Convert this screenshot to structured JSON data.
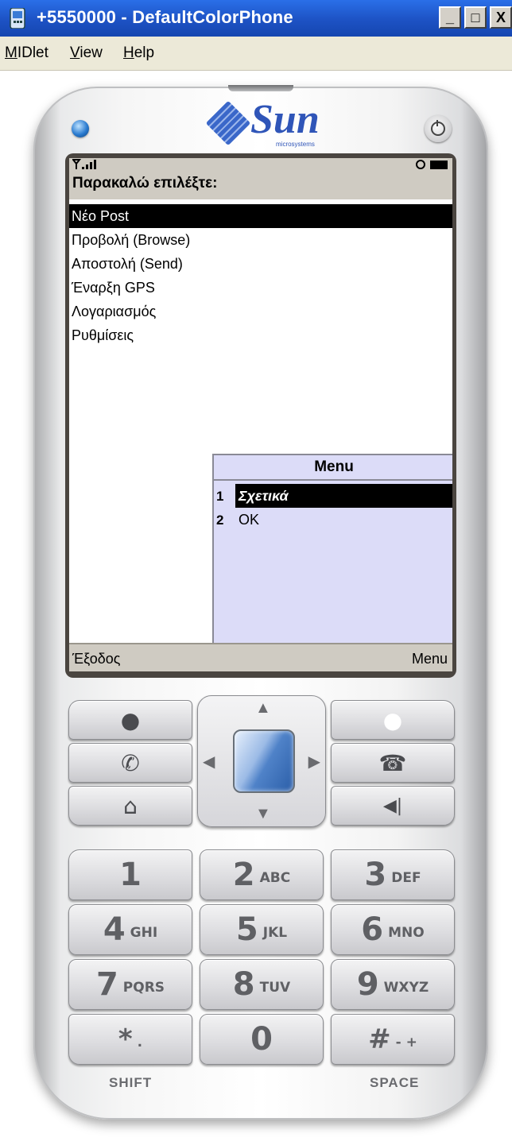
{
  "window": {
    "title": "+5550000 - DefaultColorPhone",
    "buttons": [
      "_",
      "□",
      "X"
    ]
  },
  "menubar": {
    "items": [
      {
        "label": "MIDlet",
        "accel": "M"
      },
      {
        "label": "View",
        "accel": "V"
      },
      {
        "label": "Help",
        "accel": "H"
      }
    ]
  },
  "phone": {
    "brand": "Sun",
    "brand_sub": "microsystems",
    "screen": {
      "heading": "Παρακαλώ επιλέξτε:",
      "list_items": [
        "Νέο Post",
        "Προβολή (Browse)",
        "Αποστολή (Send)",
        "Έναρξη GPS",
        "Λογαριασμός",
        "Ρυθμίσεις"
      ],
      "selected_index": 0,
      "popup": {
        "title": "Menu",
        "items": [
          {
            "num": "1",
            "label": "Σχετικά"
          },
          {
            "num": "2",
            "label": "OK"
          }
        ],
        "selected_index": 0
      },
      "softkeys": {
        "left": "Έξοδος",
        "right": "Menu"
      }
    },
    "keys": {
      "k1": {
        "digit": "1",
        "letters": ""
      },
      "k2": {
        "digit": "2",
        "letters": "ABC"
      },
      "k3": {
        "digit": "3",
        "letters": "DEF"
      },
      "k4": {
        "digit": "4",
        "letters": "GHI"
      },
      "k5": {
        "digit": "5",
        "letters": "JKL"
      },
      "k6": {
        "digit": "6",
        "letters": "MNO"
      },
      "k7": {
        "digit": "7",
        "letters": "PQRS"
      },
      "k8": {
        "digit": "8",
        "letters": "TUV"
      },
      "k9": {
        "digit": "9",
        "letters": "WXYZ"
      },
      "kstar": {
        "digit": "*",
        "letters": "."
      },
      "k0": {
        "digit": "0",
        "letters": ""
      },
      "khash": {
        "digit": "#",
        "letters": "- +"
      }
    },
    "labels": {
      "shift": "SHIFT",
      "space": "SPACE"
    }
  }
}
